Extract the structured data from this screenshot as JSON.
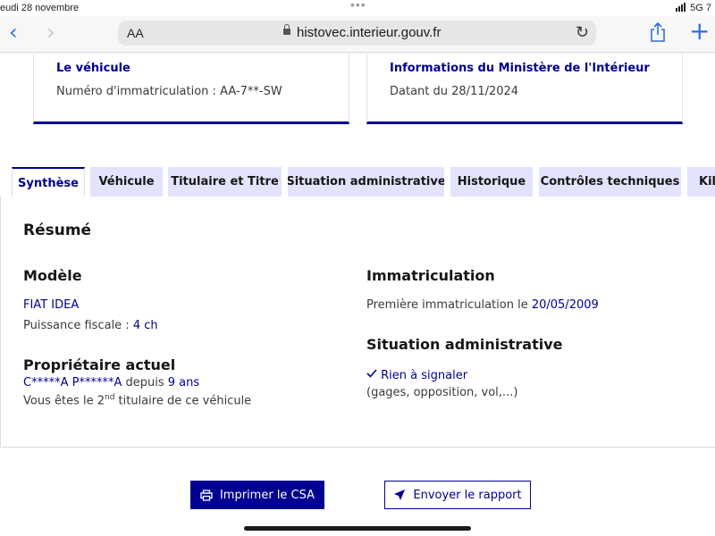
{
  "status_bar": {
    "date": "eudi 28 novembre",
    "dots": "•••",
    "network": "5G",
    "battery_text": "7"
  },
  "browser": {
    "text_size_label": "AA",
    "url": "histovec.interieur.gouv.fr",
    "back_glyph": "‹",
    "forward_glyph": "›",
    "reload_glyph": "↻",
    "new_tab_glyph": "+"
  },
  "cards": [
    {
      "title": "Le véhicule",
      "text": "Numéro d'immatriculation : AA-7**-SW"
    },
    {
      "title": "Informations du Ministère de l'Intérieur",
      "text": "Datant du 28/11/2024"
    }
  ],
  "tabs": [
    {
      "label": "Synthèse",
      "active": true
    },
    {
      "label": "Véhicule"
    },
    {
      "label": "Titulaire et Titre"
    },
    {
      "label": "Situation administrative"
    },
    {
      "label": "Historique"
    },
    {
      "label": "Contrôles techniques"
    },
    {
      "label": "Kilo"
    }
  ],
  "summary": {
    "heading": "Résumé",
    "model": {
      "heading": "Modèle",
      "name": "FIAT IDEA",
      "power_label": "Puissance fiscale : ",
      "power_value": "4 ch"
    },
    "owner": {
      "heading": "Propriétaire actuel",
      "name": "C*****A P******A",
      "since_label": " depuis ",
      "since_value": "9 ans",
      "rank_prefix": "Vous êtes le 2",
      "rank_suffix": "nd",
      "rank_rest": " titulaire de ce véhicule"
    },
    "registration": {
      "heading": "Immatriculation",
      "label": "Première immatriculation le ",
      "date": "20/05/2009"
    },
    "admin": {
      "heading": "Situation administrative",
      "status": "Rien à signaler",
      "details": "(gages, opposition, vol,...)"
    }
  },
  "actions": {
    "print": "Imprimer le CSA",
    "send": "Envoyer le rapport"
  },
  "colors": {
    "primary": "#000091",
    "tab_bg": "#e3e3fd",
    "ios_blue": "#2f6fd9"
  }
}
